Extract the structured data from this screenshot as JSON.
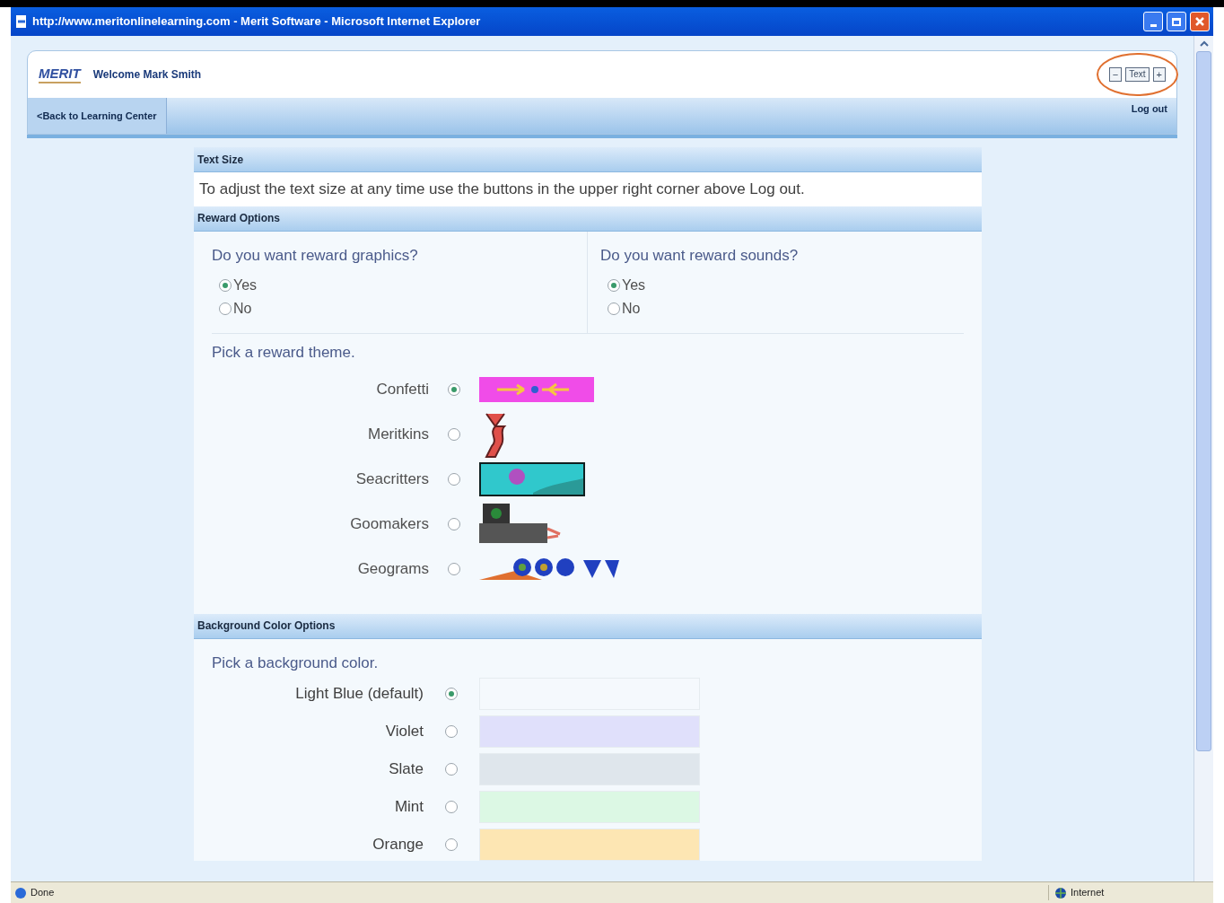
{
  "window": {
    "title": "http://www.meritonlinelearning.com - Merit Software - Microsoft Internet Explorer"
  },
  "header": {
    "logo": "MERIT",
    "welcome": "Welcome Mark Smith",
    "text_size_buttons": [
      "−",
      "Text",
      "+"
    ],
    "back_link": "<Back to Learning Center",
    "logout": "Log out"
  },
  "text_size": {
    "heading": "Text Size",
    "note": "To adjust the text size at any time use the buttons in the upper right corner above Log out."
  },
  "reward_options": {
    "heading": "Reward Options",
    "questions": [
      {
        "label": "Do you want reward graphics?",
        "options": [
          {
            "label": "Yes",
            "selected": true
          },
          {
            "label": "No",
            "selected": false
          }
        ]
      },
      {
        "label": "Do you want reward sounds?",
        "options": [
          {
            "label": "Yes",
            "selected": true
          },
          {
            "label": "No",
            "selected": false
          }
        ]
      }
    ],
    "theme_prompt": "Pick a reward theme.",
    "themes": [
      {
        "label": "Confetti",
        "selected": true,
        "kind": "confetti"
      },
      {
        "label": "Meritkins",
        "selected": false,
        "kind": "creature"
      },
      {
        "label": "Seacritters",
        "selected": false,
        "kind": "sea"
      },
      {
        "label": "Goomakers",
        "selected": false,
        "kind": "machine"
      },
      {
        "label": "Geograms",
        "selected": false,
        "kind": "shapes"
      }
    ]
  },
  "background_options": {
    "heading": "Background Color Options",
    "prompt": "Pick a background color.",
    "colors": [
      {
        "label": "Light Blue (default)",
        "selected": true,
        "color": "#f5f9fd"
      },
      {
        "label": "Violet",
        "selected": false,
        "color": "#e0e0fb"
      },
      {
        "label": "Slate",
        "selected": false,
        "color": "#dfe6ec"
      },
      {
        "label": "Mint",
        "selected": false,
        "color": "#dcf8e4"
      },
      {
        "label": "Orange",
        "selected": false,
        "color": "#fde6b3"
      }
    ]
  },
  "status_bar": {
    "status": "Done",
    "zone": "Internet"
  }
}
